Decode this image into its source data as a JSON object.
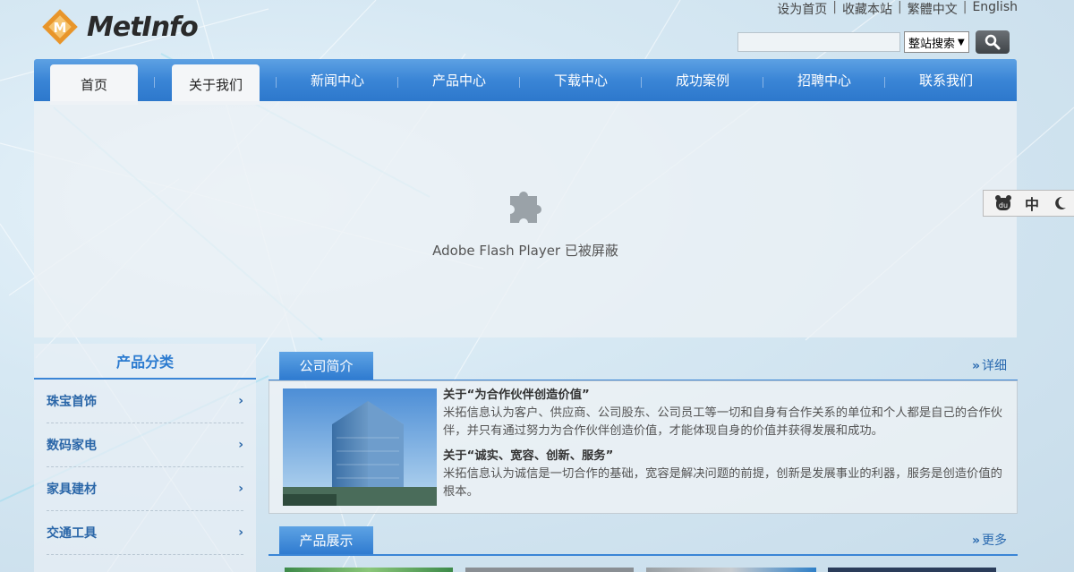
{
  "logo": {
    "text": "MetInfo",
    "mark_letter": "M",
    "colors": {
      "mark": "#e8952a",
      "text": "#2a2a2a"
    }
  },
  "top_links": [
    "设为首页",
    "收藏本站",
    "繁體中文",
    "English"
  ],
  "search": {
    "input_value": "",
    "scope": "整站搜索",
    "button_icon": "magnifier-icon"
  },
  "nav": {
    "items": [
      "首页",
      "关于我们",
      "新闻中心",
      "产品中心",
      "下载中心",
      "成功案例",
      "招聘中心",
      "联系我们"
    ]
  },
  "flash": {
    "message": "Adobe Flash Player 已被屏蔽",
    "icon": "puzzle-plugin-icon"
  },
  "sidebar": {
    "title": "产品分类",
    "categories": [
      "珠宝首饰",
      "数码家电",
      "家具建材",
      "交通工具"
    ]
  },
  "about": {
    "tab": "公司简介",
    "more": "详细",
    "items": [
      {
        "title": "关于“为合作伙伴创造价值”",
        "body": "米拓信息认为客户、供应商、公司股东、公司员工等一切和自身有合作关系的单位和个人都是自己的合作伙伴，并只有通过努力为合作伙伴创造价值，才能体现自身的价值并获得发展和成功。"
      },
      {
        "title": "关于“诚实、宽容、创新、服务”",
        "body": "米拓信息认为诚信是一切合作的基础，宽容是解决问题的前提，创新是发展事业的利器，服务是创造价值的根本。"
      }
    ]
  },
  "products": {
    "tab": "产品展示",
    "more": "更多"
  },
  "widget": {
    "lang": "中",
    "icons": [
      "bear-paw-icon",
      "moon-icon"
    ]
  },
  "colors": {
    "nav_blue": "#3a85d6",
    "link_blue": "#2a66a8"
  }
}
